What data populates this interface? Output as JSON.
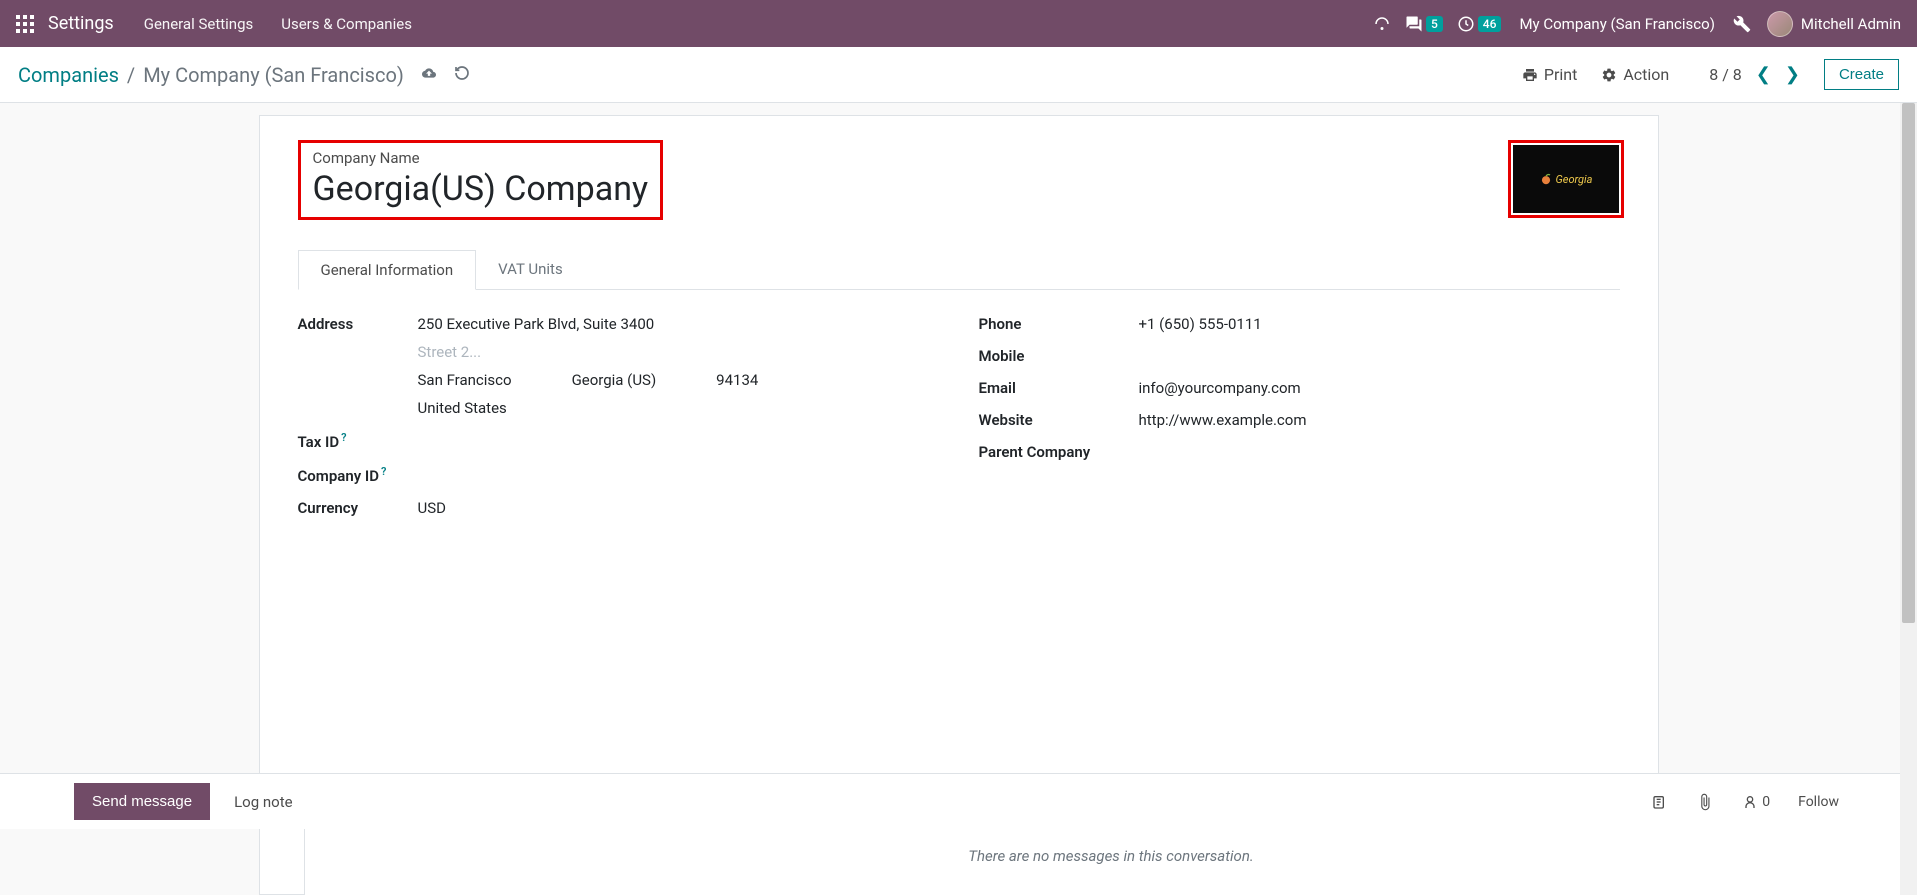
{
  "topnav": {
    "brand": "Settings",
    "links": [
      "General Settings",
      "Users & Companies"
    ],
    "msg_badge": "5",
    "clock_badge": "46",
    "company": "My Company (San Francisco)",
    "user": "Mitchell Admin"
  },
  "breadcrumb": {
    "root": "Companies",
    "current": "My Company (San Francisco)"
  },
  "controls": {
    "print": "Print",
    "action": "Action",
    "pager": "8 / 8",
    "create": "Create"
  },
  "form": {
    "title_label": "Company Name",
    "title_value": "Georgia(US) Company",
    "logo_text": "Georgia",
    "tabs": [
      "General Information",
      "VAT Units"
    ],
    "left": {
      "address_label": "Address",
      "street": "250 Executive Park Blvd, Suite 3400",
      "street2_ph": "Street 2...",
      "city": "San Francisco",
      "state": "Georgia (US)",
      "zip": "94134",
      "country": "United States",
      "tax_id_label": "Tax ID",
      "company_id_label": "Company ID",
      "currency_label": "Currency",
      "currency": "USD"
    },
    "right": {
      "phone_label": "Phone",
      "phone": "+1 (650) 555-0111",
      "mobile_label": "Mobile",
      "email_label": "Email",
      "email": "info@yourcompany.com",
      "website_label": "Website",
      "website": "http://www.example.com",
      "parent_label": "Parent Company"
    }
  },
  "chatter": {
    "send": "Send message",
    "log": "Log note",
    "followers": "0",
    "follow": "Follow",
    "empty": "There are no messages in this conversation."
  }
}
